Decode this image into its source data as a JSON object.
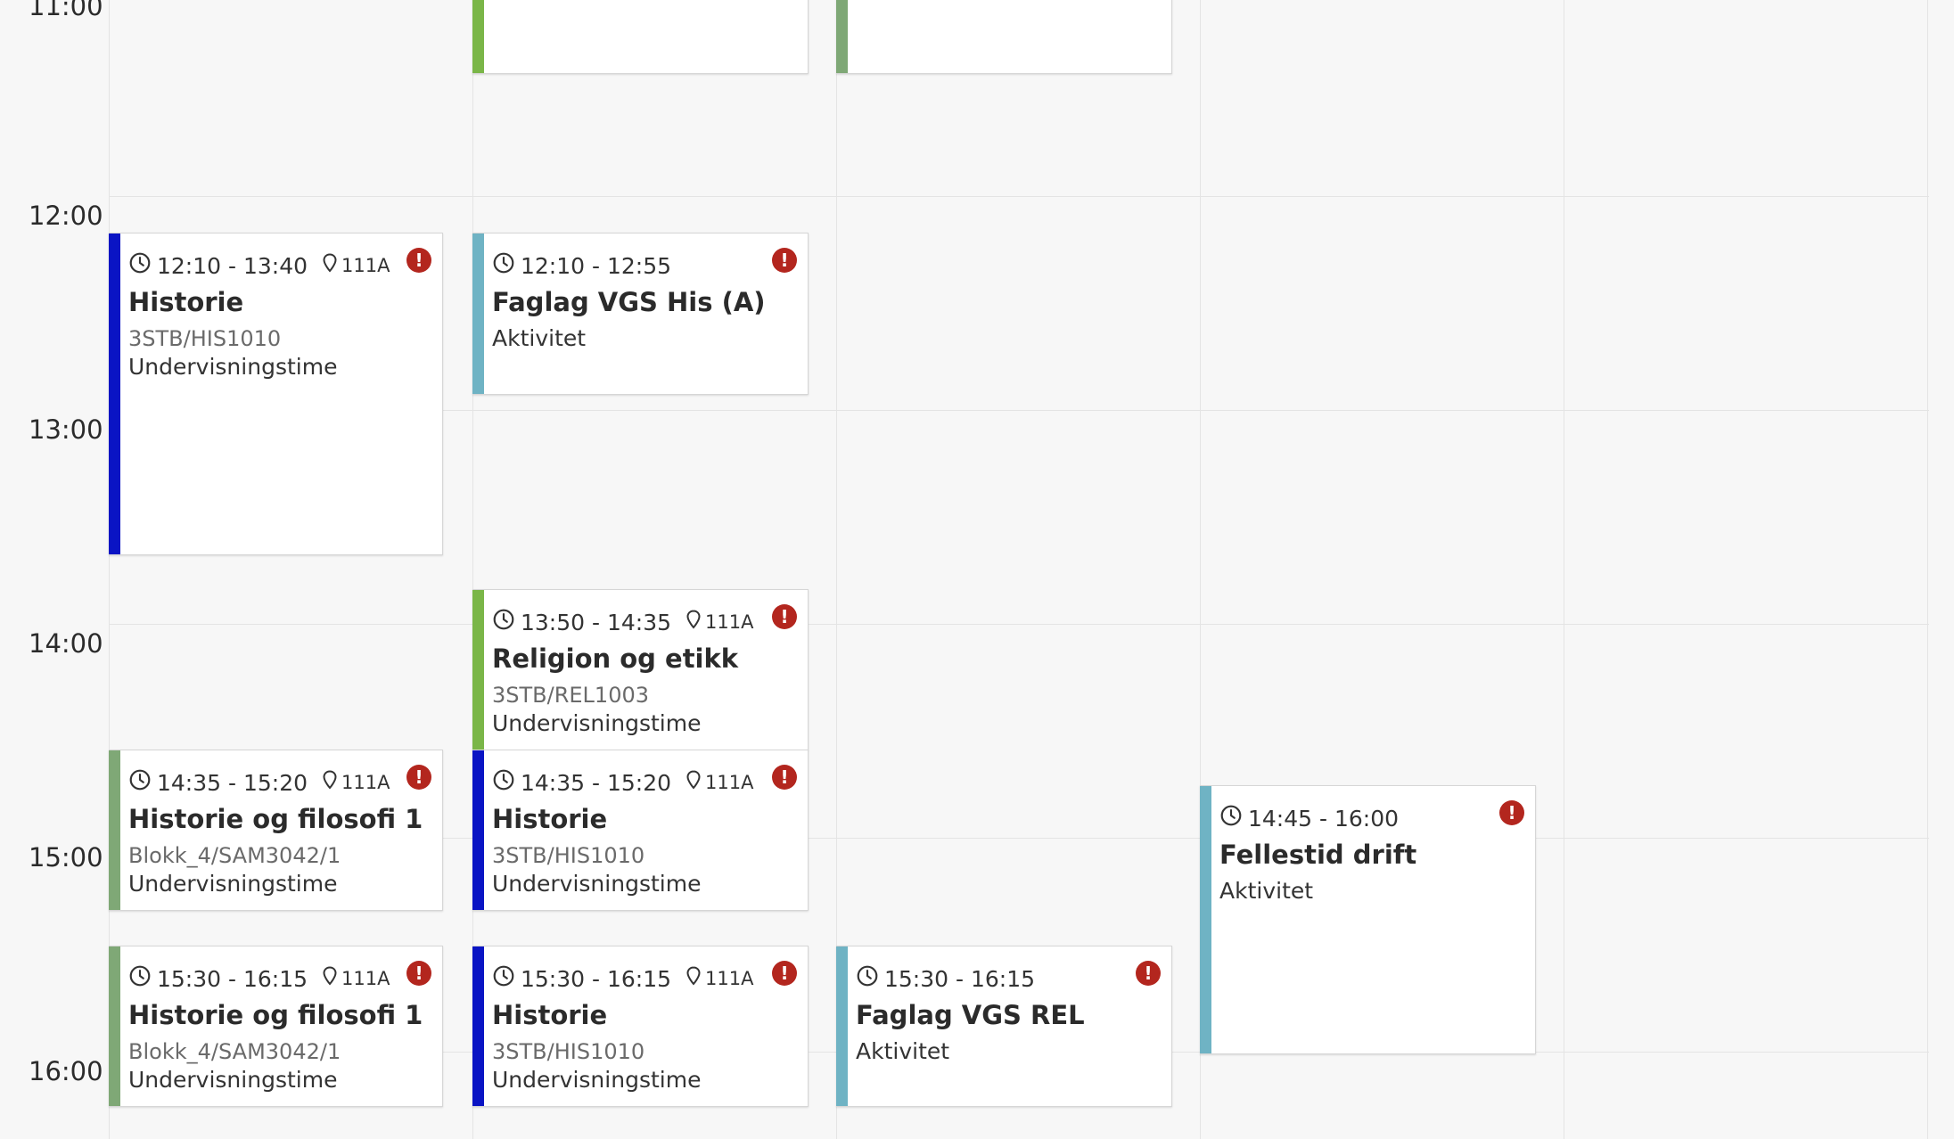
{
  "time_labels": [
    "11:00",
    "12:00",
    "13:00",
    "14:00",
    "15:00",
    "16:00"
  ],
  "colors": {
    "blue": "#0a14c4",
    "green": "#7ab648",
    "sage": "#7fa876",
    "teal": "#6fb3c4",
    "alert": "#b3261e"
  },
  "events": [
    {
      "color": "green",
      "time": "",
      "room": "",
      "title": "",
      "code": "",
      "kind": ""
    },
    {
      "color": "sage",
      "time": "",
      "room": "",
      "title": "",
      "code": "",
      "kind": ""
    },
    {
      "color": "blue",
      "time": "12:10 - 13:40",
      "room": "111A",
      "title": "Historie",
      "code": "3STB/HIS1010",
      "kind": "Undervisningstime"
    },
    {
      "color": "teal",
      "time": "12:10 - 12:55",
      "room": "",
      "title": "Faglag VGS His (A)",
      "code": "",
      "kind": "Aktivitet"
    },
    {
      "color": "green",
      "time": "13:50 - 14:35",
      "room": "111A",
      "title": "Religion og etikk",
      "code": "3STB/REL1003",
      "kind": "Undervisningstime"
    },
    {
      "color": "sage",
      "time": "14:35 - 15:20",
      "room": "111A",
      "title": "Historie og filosofi 1",
      "code": "Blokk_4/SAM3042/1",
      "kind": "Undervisningstime"
    },
    {
      "color": "blue",
      "time": "14:35 - 15:20",
      "room": "111A",
      "title": "Historie",
      "code": "3STB/HIS1010",
      "kind": "Undervisningstime"
    },
    {
      "color": "teal",
      "time": "14:45 - 16:00",
      "room": "",
      "title": "Fellestid drift",
      "code": "",
      "kind": "Aktivitet"
    },
    {
      "color": "sage",
      "time": "15:30 - 16:15",
      "room": "111A",
      "title": "Historie og filosofi 1",
      "code": "Blokk_4/SAM3042/1",
      "kind": "Undervisningstime"
    },
    {
      "color": "blue",
      "time": "15:30 - 16:15",
      "room": "111A",
      "title": "Historie",
      "code": "3STB/HIS1010",
      "kind": "Undervisningstime"
    },
    {
      "color": "teal",
      "time": "15:30 - 16:15",
      "room": "",
      "title": "Faglag VGS REL",
      "code": "",
      "kind": "Aktivitet"
    }
  ]
}
